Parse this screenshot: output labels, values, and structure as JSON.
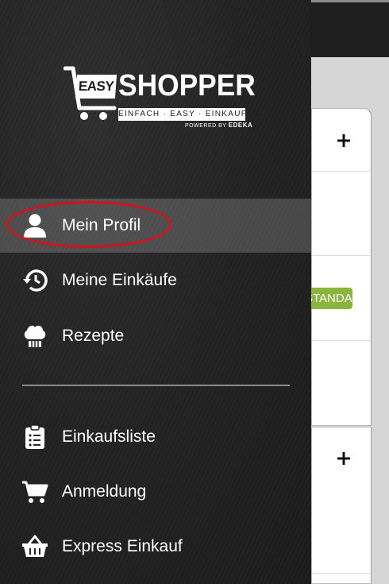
{
  "logo": {
    "easy": "EASY",
    "shopper": "SHOPPER",
    "tagline": "EINFACH · EASY · EINKAUFEN",
    "powered_by": "POWERED BY",
    "powered_brand": "EDEKA"
  },
  "menu": {
    "items": [
      {
        "label": "Mein Profil",
        "icon": "person-icon",
        "active": true
      },
      {
        "label": "Meine Einkäufe",
        "icon": "history-icon",
        "active": false
      },
      {
        "label": "Rezepte",
        "icon": "chef-hat-icon",
        "active": false
      },
      {
        "label": "Einkaufsliste",
        "icon": "clipboard-list-icon",
        "active": false
      },
      {
        "label": "Anmeldung",
        "icon": "shopping-cart-icon",
        "active": false
      },
      {
        "label": "Express Einkauf",
        "icon": "basket-icon",
        "active": false
      }
    ]
  },
  "background": {
    "badge_label": "STANDARD",
    "badge_color": "#8ab63d",
    "add_icon": "plus-icon"
  },
  "colors": {
    "drawer_bg": "#242424",
    "highlight": "#d8121b",
    "active_row": "#505050"
  }
}
